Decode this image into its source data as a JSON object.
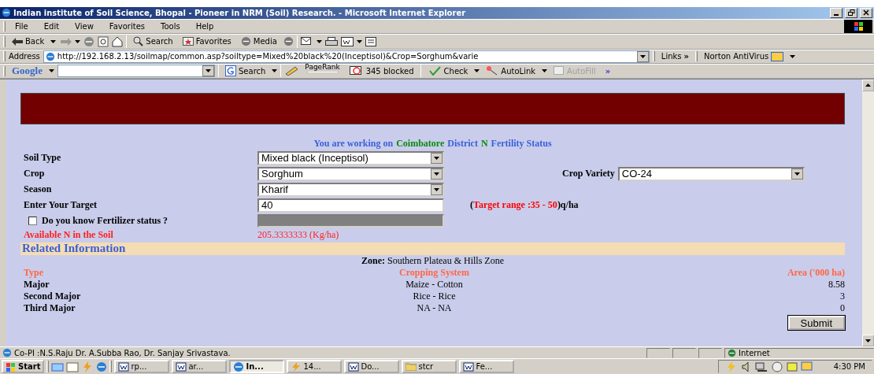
{
  "window": {
    "title": "Indian institute of Soil Science, Bhopal - Pioneer in NRM (Soil) Research. - Microsoft Internet Explorer"
  },
  "menu": [
    {
      "label": "File"
    },
    {
      "label": "Edit"
    },
    {
      "label": "View"
    },
    {
      "label": "Favorites"
    },
    {
      "label": "Tools"
    },
    {
      "label": "Help"
    }
  ],
  "toolbar": {
    "back": "Back",
    "search": "Search",
    "favorites": "Favorites",
    "media": "Media"
  },
  "address": {
    "label": "Address",
    "url": "http://192.168.2.13/soilmap/common.asp?soiltype=Mixed%20black%20(Inceptisol)&Crop=Sorghum&varie",
    "links": "Links",
    "links_more": "»",
    "norton": "Norton AntiVirus"
  },
  "google_bar": {
    "logo": "Google",
    "search": "Search",
    "pagerank": "PageRank",
    "blocked": "345 blocked",
    "check": "Check",
    "autolink": "AutoLink",
    "autofill": {
      "label": "AutoFill",
      "disabled": true
    },
    "more": "»"
  },
  "page": {
    "heading": [
      {
        "text": "You are working on",
        "color": "#3b5fd9"
      },
      {
        "text": "Coimbatore",
        "color": "#0a8a0a"
      },
      {
        "text": "District",
        "color": "#3b5fd9"
      },
      {
        "text": "N",
        "color": "#0a8a0a"
      },
      {
        "text": "Fertility Status",
        "color": "#3b5fd9"
      }
    ],
    "fields": [
      {
        "kind": "select",
        "label": "Soil Type",
        "value": "Mixed black (Inceptisol)"
      },
      {
        "kind": "select",
        "label": "Crop",
        "value": "Sorghum",
        "side": {
          "label": "Crop Variety",
          "value": "CO-24"
        }
      },
      {
        "kind": "select",
        "label": "Season",
        "value": "Kharif"
      },
      {
        "kind": "text",
        "label": "Enter Your Target",
        "value": "40",
        "note": [
          {
            "text": "(",
            "color": "#000000"
          },
          {
            "text": "Target range :35 - 50",
            "color": "#ff0000"
          },
          {
            "text": ")q/ha",
            "color": "#000000"
          }
        ]
      }
    ],
    "fertilizer": {
      "label": "Do you know Fertilizer status ?",
      "checked": false
    },
    "available": {
      "label": "Available N in the Soil",
      "value": "205.3333333 (Kg/ha)"
    },
    "related_title": "Related Information",
    "zone": {
      "label": "Zone:",
      "value": "Southern Plateau & Hills Zone"
    },
    "table": {
      "columns": [
        "Type",
        "Cropping System",
        "Area ('000 ha)"
      ],
      "rows": [
        [
          "Major",
          "Maize - Cotton",
          "8.58"
        ],
        [
          "Second Major",
          "Rice - Rice",
          "3"
        ],
        [
          "Third Major",
          "NA - NA",
          "0"
        ]
      ]
    },
    "submit": "Submit"
  },
  "status_bar": {
    "text": "Co-PI :N.S.Raju Dr. A.Subba Rao, Dr. Sanjay Srivastava.",
    "zone": "Internet"
  },
  "taskbar": {
    "start": "Start",
    "tasks": [
      {
        "label": "rp...",
        "kind": "doc",
        "selected": false
      },
      {
        "label": "ar...",
        "kind": "doc",
        "selected": false
      },
      {
        "label": "In...",
        "kind": "ie",
        "selected": true
      },
      {
        "label": "14...",
        "kind": "app",
        "selected": false
      },
      {
        "label": "Do...",
        "kind": "doc",
        "selected": false
      },
      {
        "label": "stcr",
        "kind": "folder",
        "selected": false
      },
      {
        "label": "Fe...",
        "kind": "doc",
        "selected": false
      }
    ],
    "clock": "4:30 PM"
  }
}
